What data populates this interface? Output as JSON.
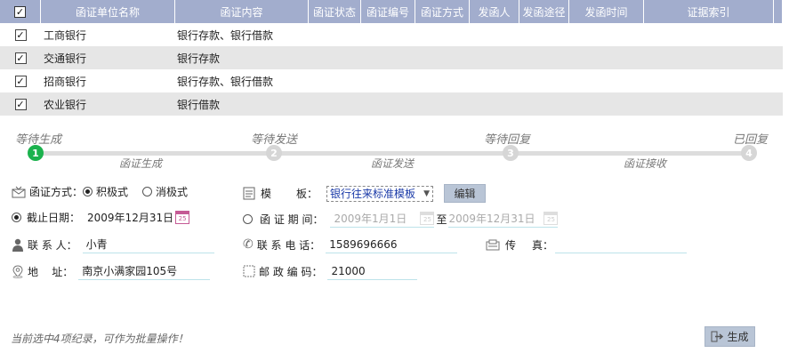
{
  "table": {
    "headers": [
      "函证单位名称",
      "函证内容",
      "函证状态",
      "函证编号",
      "函证方式",
      "发函人",
      "发函途径",
      "发函时间",
      "证据索引"
    ],
    "rows": [
      {
        "unit": "工商银行",
        "content": "银行存款、银行借款"
      },
      {
        "unit": "交通银行",
        "content": "银行存款"
      },
      {
        "unit": "招商银行",
        "content": "银行存款、银行借款"
      },
      {
        "unit": "农业银行",
        "content": "银行借款"
      }
    ],
    "check_mark": "✓"
  },
  "steps": {
    "labels": [
      "等待生成",
      "等待发送",
      "等待回复",
      "已回复"
    ],
    "numbers": [
      "1",
      "2",
      "3",
      "4"
    ],
    "sublabels": [
      "函证生成",
      "函证发送",
      "函证接收"
    ],
    "active_color": "#1bb24d"
  },
  "form": {
    "method_label": "函证方式：",
    "method_opt1": "积极式",
    "method_opt2": "消极式",
    "template_label_a": "模",
    "template_label_b": "板：",
    "template_value": "银行往来标准模板",
    "edit_button": "编辑",
    "cutoff_label": "截止日期：",
    "cutoff_value": "2009年12月31日",
    "period_label": "函 证 期 间：",
    "period_from": "2009年1月1日",
    "period_to_sep": "至",
    "period_to": "2009年12月31日",
    "contact_label": "联 系 人：",
    "contact_value": "小青",
    "phone_label": "联 系 电 话：",
    "phone_value": "1589696666",
    "fax_label_a": "传",
    "fax_label_b": "真：",
    "fax_value": "",
    "address_label": "地    址：",
    "address_value": "南京小满家园105号",
    "postal_label": "邮 政 编 码：",
    "postal_value": "21000",
    "cal_text": "25"
  },
  "status_text": "当前选中4项纪录，可作为批量操作！",
  "generate_button": "生成"
}
